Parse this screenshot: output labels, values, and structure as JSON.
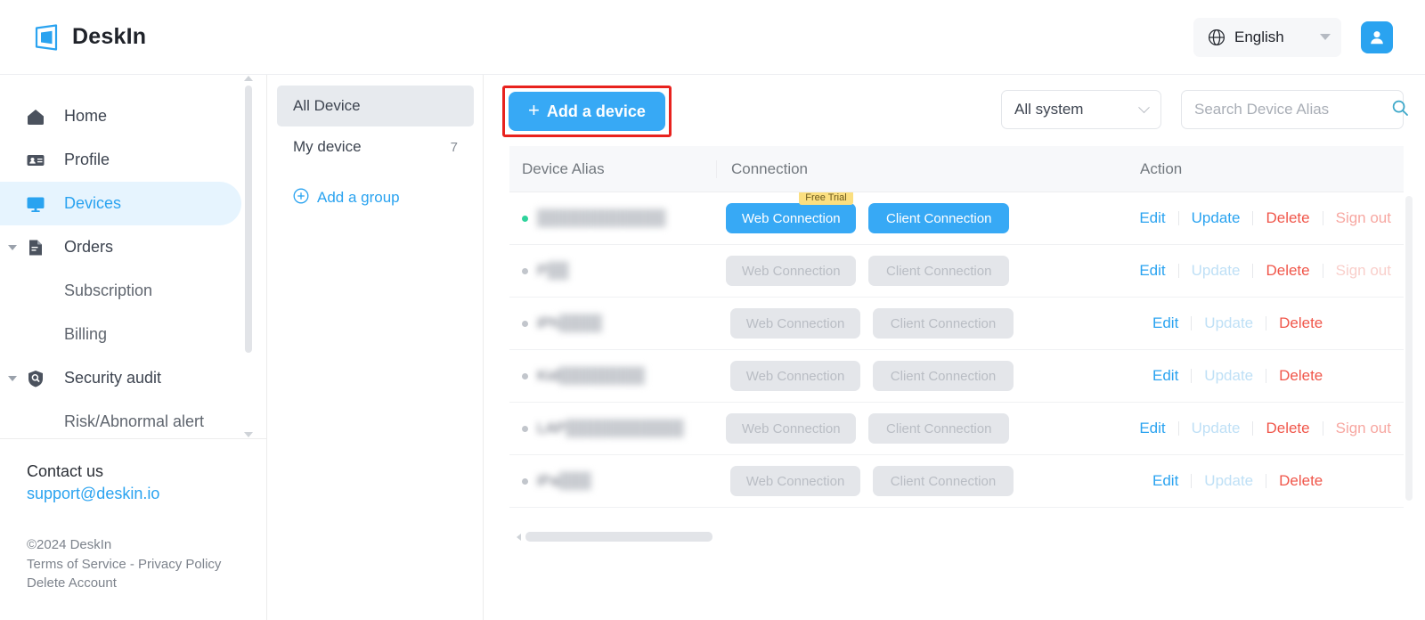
{
  "header": {
    "brand": "DeskIn",
    "logo_icon": "deskin-logo-icon",
    "language": {
      "icon": "globe-icon",
      "label": "English",
      "caret": "chevron-down-icon"
    },
    "account_icon": "user-avatar-icon"
  },
  "sidebar": {
    "items": [
      {
        "label": "Home",
        "icon": "home-icon",
        "type": "item",
        "active": false
      },
      {
        "label": "Profile",
        "icon": "id-card-icon",
        "type": "item",
        "active": false
      },
      {
        "label": "Devices",
        "icon": "monitor-icon",
        "type": "item",
        "active": true
      },
      {
        "label": "Orders",
        "icon": "document-icon",
        "type": "group",
        "active": false
      },
      {
        "label": "Subscription",
        "icon": "",
        "type": "sub",
        "active": false
      },
      {
        "label": "Billing",
        "icon": "",
        "type": "sub",
        "active": false
      },
      {
        "label": "Security audit",
        "icon": "shield-search-icon",
        "type": "group",
        "active": false
      },
      {
        "label": "Risk/Abnormal alert",
        "icon": "",
        "type": "sub",
        "active": false
      }
    ],
    "contact": {
      "title": "Contact us",
      "email": "support@deskin.io"
    },
    "legal": {
      "copyright": "©2024 DeskIn",
      "terms": "Terms of Service",
      "separator": " - ",
      "privacy": "Privacy Policy",
      "delete_account": "Delete Account"
    }
  },
  "groups": {
    "items": [
      {
        "label": "All Device",
        "count": "",
        "active": true
      },
      {
        "label": "My device",
        "count": "7",
        "active": false
      }
    ],
    "add_group": {
      "label": "Add a group",
      "icon": "plus-circle-icon"
    }
  },
  "toolbar": {
    "add_device_label": "Add a device",
    "add_device_plus": "+",
    "highlight_color": "#e8221e",
    "system_filter": {
      "value": "All system",
      "icon": "chevron-down-icon"
    },
    "search": {
      "placeholder": "Search Device Alias",
      "value": "",
      "icon": "search-icon"
    }
  },
  "table": {
    "columns": [
      "Device Alias",
      "Connection",
      "Action"
    ],
    "rows": [
      {
        "alias": "",
        "alias_prefix": "",
        "alias_blur_width": 112,
        "status": "online",
        "web": {
          "label": "Web Connection",
          "enabled": true,
          "badge": "Free Trial"
        },
        "client": {
          "label": "Client Connection",
          "enabled": true
        },
        "actions": [
          {
            "label": "Edit",
            "state": "edit"
          },
          {
            "label": "Update",
            "state": "update-on"
          },
          {
            "label": "Delete",
            "state": "delete"
          },
          {
            "label": "Sign out",
            "state": "signout-on"
          }
        ]
      },
      {
        "alias": "",
        "alias_prefix": "P",
        "alias_blur_width": 18,
        "status": "offline",
        "web": {
          "label": "Web Connection",
          "enabled": false,
          "badge": ""
        },
        "client": {
          "label": "Client Connection",
          "enabled": false
        },
        "actions": [
          {
            "label": "Edit",
            "state": "edit"
          },
          {
            "label": "Update",
            "state": "update-off"
          },
          {
            "label": "Delete",
            "state": "delete"
          },
          {
            "label": "Sign out",
            "state": "signout-off"
          }
        ]
      },
      {
        "alias": "",
        "alias_prefix": "iPh",
        "alias_blur_width": 40,
        "status": "offline",
        "web": {
          "label": "Web Connection",
          "enabled": false,
          "badge": ""
        },
        "client": {
          "label": "Client Connection",
          "enabled": false
        },
        "actions": [
          {
            "label": "Edit",
            "state": "edit"
          },
          {
            "label": "Update",
            "state": "update-off"
          },
          {
            "label": "Delete",
            "state": "delete"
          }
        ]
      },
      {
        "alias": "",
        "alias_prefix": "Kid",
        "alias_blur_width": 72,
        "status": "offline",
        "web": {
          "label": "Web Connection",
          "enabled": false,
          "badge": ""
        },
        "client": {
          "label": "Client Connection",
          "enabled": false
        },
        "actions": [
          {
            "label": "Edit",
            "state": "edit"
          },
          {
            "label": "Update",
            "state": "update-off"
          },
          {
            "label": "Delete",
            "state": "delete"
          }
        ]
      },
      {
        "alias": "",
        "alias_prefix": "LAP",
        "alias_blur_width": 100,
        "status": "offline",
        "web": {
          "label": "Web Connection",
          "enabled": false,
          "badge": ""
        },
        "client": {
          "label": "Client Connection",
          "enabled": false
        },
        "actions": [
          {
            "label": "Edit",
            "state": "edit"
          },
          {
            "label": "Update",
            "state": "update-off"
          },
          {
            "label": "Delete",
            "state": "delete"
          },
          {
            "label": "Sign out",
            "state": "signout-on"
          }
        ]
      },
      {
        "alias": "",
        "alias_prefix": "iPa",
        "alias_blur_width": 26,
        "status": "offline",
        "web": {
          "label": "Web Connection",
          "enabled": false,
          "badge": ""
        },
        "client": {
          "label": "Client Connection",
          "enabled": false
        },
        "actions": [
          {
            "label": "Edit",
            "state": "edit"
          },
          {
            "label": "Update",
            "state": "update-off"
          },
          {
            "label": "Delete",
            "state": "delete"
          }
        ]
      }
    ]
  },
  "colors": {
    "accent": "#2aa3f0",
    "button": "#37a9f5",
    "danger": "#f0564a",
    "online": "#2fd39c",
    "badge": "#fbdf80",
    "highlight": "#e8221e"
  }
}
